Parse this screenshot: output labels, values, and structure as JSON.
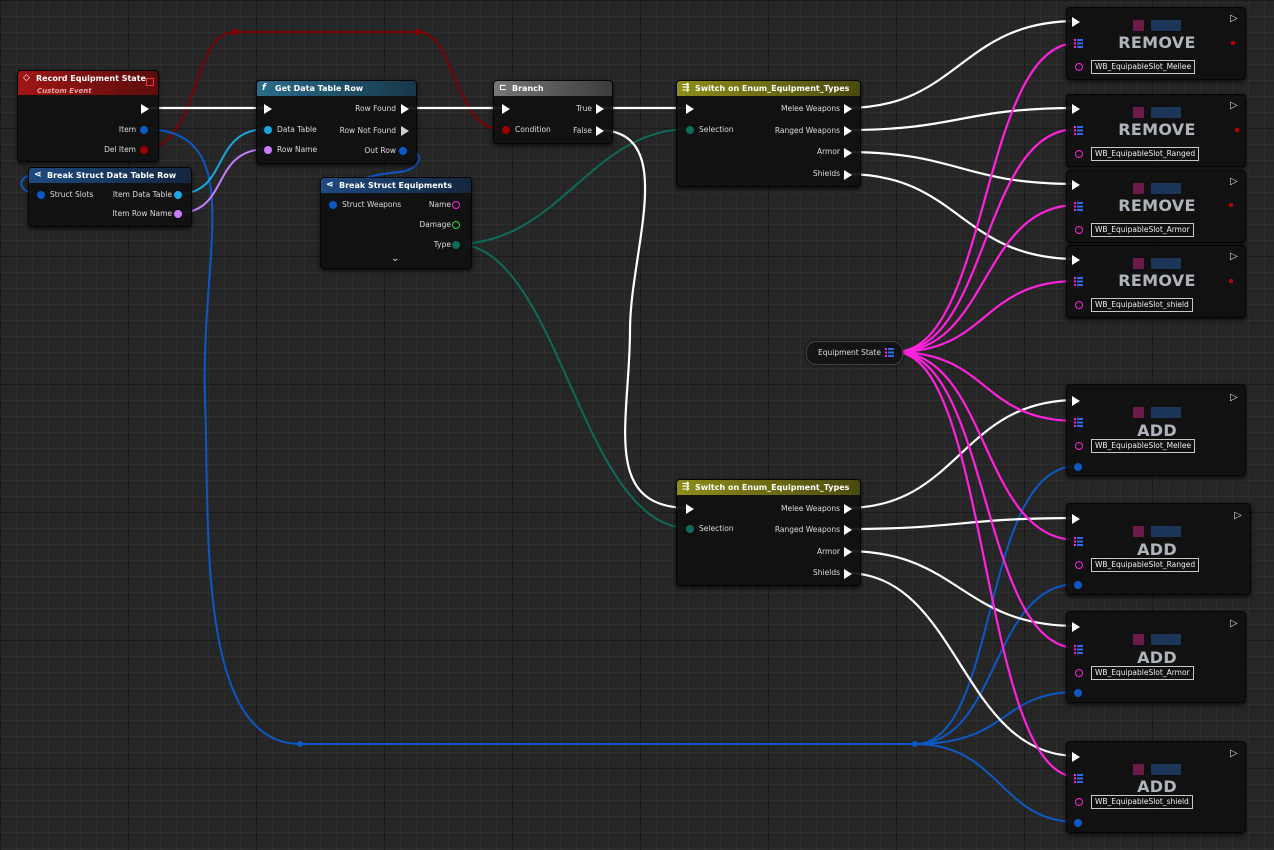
{
  "nodes": {
    "record_state": {
      "title": "Record Equipment State",
      "subtitle": "Custom Event",
      "pins": {
        "item": "Item",
        "del_item": "Del Item"
      }
    },
    "break_row": {
      "title": "Break Struct Data Table Row",
      "pins": {
        "struct_slots": "Struct Slots",
        "item_data_table": "Item Data Table",
        "item_row_name": "Item Row Name"
      }
    },
    "get_row": {
      "title": "Get Data Table Row",
      "pins": {
        "data_table": "Data Table",
        "row_name": "Row Name",
        "row_found": "Row Found",
        "row_not_found": "Row Not Found",
        "out_row": "Out Row"
      }
    },
    "break_equip": {
      "title": "Break Struct Equipments",
      "pins": {
        "struct_weapons": "Struct Weapons",
        "name": "Name",
        "damage": "Damage",
        "type": "Type"
      }
    },
    "branch": {
      "title": "Branch",
      "pins": {
        "condition": "Condition",
        "true": "True",
        "false": "False"
      }
    },
    "switch_top": {
      "title": "Switch on Enum_Equipment_Types",
      "pins": {
        "selection": "Selection",
        "melee": "Melee Weapons",
        "ranged": "Ranged Weapons",
        "armor": "Armor",
        "shields": "Shields"
      }
    },
    "switch_bottom": {
      "title": "Switch on Enum_Equipment_Types",
      "pins": {
        "selection": "Selection",
        "melee": "Melee Weapons",
        "ranged": "Ranged Weapons",
        "armor": "Armor",
        "shields": "Shields"
      }
    },
    "equipment_state": {
      "label": "Equipment State"
    }
  },
  "remove_nodes": [
    {
      "label": "REMOVE",
      "slot": "WB_EquipableSlot_Mellee"
    },
    {
      "label": "REMOVE",
      "slot": "WB_EquipableSlot_Ranged"
    },
    {
      "label": "REMOVE",
      "slot": "WB_EquipableSlot_Armor"
    },
    {
      "label": "REMOVE",
      "slot": "WB_EquipableSlot_shield"
    }
  ],
  "add_nodes": [
    {
      "label": "ADD",
      "slot": "WB_EquipableSlot_Mellee"
    },
    {
      "label": "ADD",
      "slot": "WB_EquipableSlot_Ranged"
    },
    {
      "label": "ADD",
      "slot": "WB_EquipableSlot_Armor"
    },
    {
      "label": "ADD",
      "slot": "WB_EquipableSlot_shield"
    }
  ],
  "colors": {
    "exec": "#ffffff",
    "struct": "#0a5bd0",
    "enum": "#0e6a5a",
    "array": "#ff22dd",
    "bool": "#9b0000",
    "datatable": "#1aa6e0",
    "name": "#c77cff"
  }
}
